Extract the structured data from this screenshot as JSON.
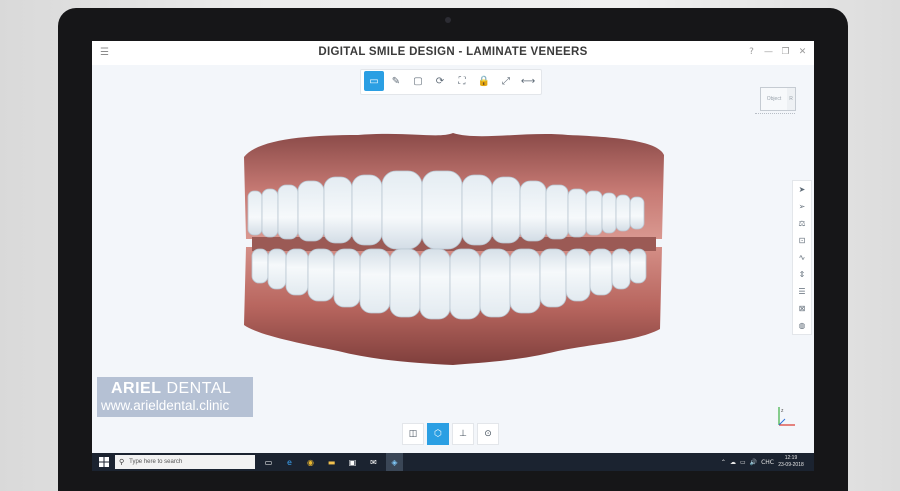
{
  "window": {
    "title": "DIGITAL SMILE DESIGN - LAMINATE VENEERS",
    "menu_icon": "hamburger-icon",
    "controls": [
      "?",
      "—",
      "❐",
      "✕"
    ]
  },
  "toolbar": {
    "tools": [
      {
        "icon": "folder-open-icon",
        "glyph": "▭",
        "active": true
      },
      {
        "icon": "pencil-icon",
        "glyph": "✎",
        "active": false
      },
      {
        "icon": "folder-icon",
        "glyph": "▢",
        "active": false
      },
      {
        "icon": "rotate-icon",
        "glyph": "⟳",
        "active": false
      },
      {
        "icon": "crop-icon",
        "glyph": "⛶",
        "active": false
      },
      {
        "icon": "lock-icon",
        "glyph": "🔒",
        "active": false
      },
      {
        "icon": "expand-icon",
        "glyph": "⤢",
        "active": false
      },
      {
        "icon": "measure-icon",
        "glyph": "⟷",
        "active": false
      }
    ]
  },
  "viewcube": {
    "front_label": "Object",
    "side_label": "R"
  },
  "side_tools": {
    "icons": [
      {
        "icon": "select-arrow-icon",
        "glyph": "➤"
      },
      {
        "icon": "pointer-icon",
        "glyph": "➢"
      },
      {
        "icon": "tooth-compare-icon",
        "glyph": "⚖"
      },
      {
        "icon": "tooth-box-icon",
        "glyph": "⊡"
      },
      {
        "icon": "curve-icon",
        "glyph": "∿"
      },
      {
        "icon": "spacing-icon",
        "glyph": "⇕"
      },
      {
        "icon": "layers-icon",
        "glyph": "☰"
      },
      {
        "icon": "scan-icon",
        "glyph": "⊠"
      },
      {
        "icon": "color-wheel-icon",
        "glyph": "◍"
      }
    ]
  },
  "bottom_tools": {
    "icons": [
      {
        "icon": "tooth-view-icon",
        "glyph": "◫",
        "active": false
      },
      {
        "icon": "shield-tooth-icon",
        "glyph": "⬡",
        "active": true
      },
      {
        "icon": "implant-icon",
        "glyph": "⊥",
        "active": false
      },
      {
        "icon": "target-icon",
        "glyph": "⊙",
        "active": false
      }
    ]
  },
  "taskbar": {
    "search_placeholder": "Type here to search",
    "apps": [
      {
        "icon": "task-view-icon",
        "glyph": "▭",
        "color": "#ffffff",
        "active": false
      },
      {
        "icon": "edge-icon",
        "glyph": "e",
        "color": "#3aa0f0",
        "active": false
      },
      {
        "icon": "chrome-icon",
        "glyph": "◉",
        "color": "#e9b730",
        "active": false
      },
      {
        "icon": "file-explorer-icon",
        "glyph": "▬",
        "color": "#f2c14e",
        "active": false
      },
      {
        "icon": "store-icon",
        "glyph": "▣",
        "color": "#ffffff",
        "active": false
      },
      {
        "icon": "mail-icon",
        "glyph": "✉",
        "color": "#ffffff",
        "active": false
      },
      {
        "icon": "dental-app-icon",
        "glyph": "◈",
        "color": "#7fc8f8",
        "active": true
      }
    ],
    "tray_icons": [
      "⌃",
      "☁",
      "▭",
      "🔊"
    ],
    "language": "CHC",
    "time": "12:19",
    "date": "23-09-2018"
  },
  "watermark": {
    "brand_bold": "ARIEL",
    "brand_rest": " DENTAL",
    "url": "www.arieldental.clinic"
  },
  "colors": {
    "accent": "#2b9fe3",
    "taskbar": "#1b2330",
    "canvas": "#f3f6fa"
  }
}
